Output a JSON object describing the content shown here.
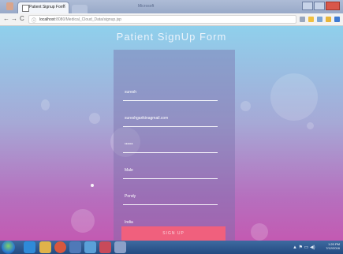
{
  "browser": {
    "tab_title": "Patient Signup Form",
    "tab_close": "×",
    "window_caption": "Microsoft",
    "back": "←",
    "forward": "→",
    "reload": "C",
    "info_icon": "ⓘ",
    "url_host": "localhost",
    "url_path": ":8080/Medical_Cloud_Data/signup.jsp"
  },
  "page": {
    "title": "Patient SignUp Form",
    "fields": [
      {
        "name": "name-field",
        "value": "suresh"
      },
      {
        "name": "email-field",
        "value": "sureshgarikinagmail.com"
      },
      {
        "name": "password-field",
        "value": "••••••"
      },
      {
        "name": "gender-field",
        "value": "Male"
      },
      {
        "name": "city-field",
        "value": "Pondy"
      },
      {
        "name": "country-field",
        "value": "India"
      }
    ],
    "signup_label": "SIGN UP"
  },
  "taskbar": {
    "tray_icons": "▲ ⚑ ▭ ◀)",
    "time": "1:20 PM",
    "date": "7/12/2016"
  },
  "colors": {
    "accent_button": "#f0607d",
    "bg_top": "#8fd0ec",
    "bg_bottom": "#c35ab2"
  }
}
